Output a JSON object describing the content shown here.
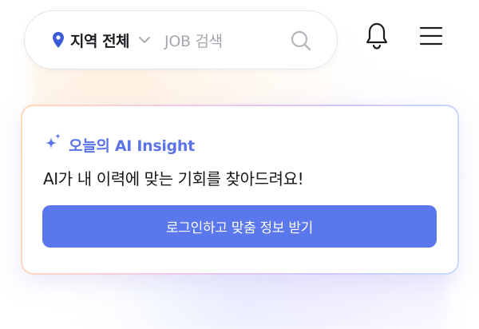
{
  "header": {
    "region_label": "지역 전체",
    "search_placeholder": "JOB 검색",
    "icons": [
      "location-pin-icon",
      "chevron-down-icon",
      "search-icon",
      "bell-icon",
      "menu-icon"
    ]
  },
  "insight_card": {
    "title": "오늘의 AI Insight",
    "message": "AI가 내 이력에 맞는 기회를 찾아드려요!",
    "cta_label": "로그인하고 맞춤 정보 받기",
    "icon": "sparkle-icon"
  },
  "colors": {
    "accent": "#5a77ec",
    "title_accent": "#5b74e8",
    "pin": "#3b5bdb",
    "placeholder": "#a4a7ae"
  }
}
